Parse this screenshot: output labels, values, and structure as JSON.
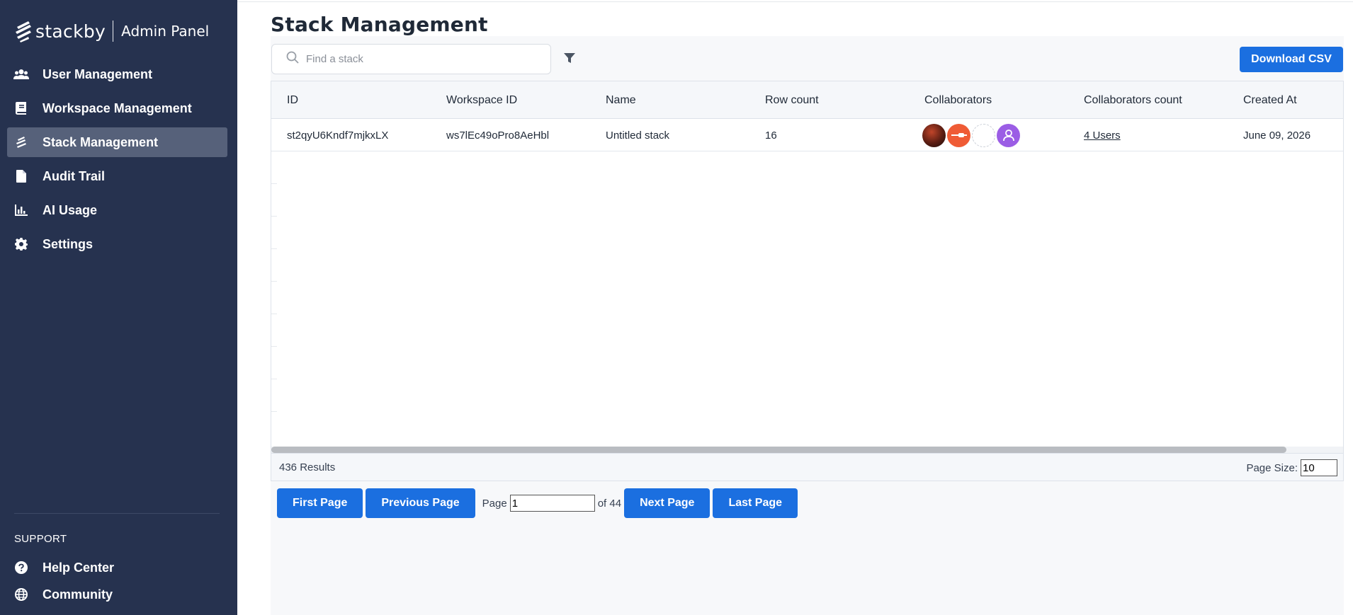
{
  "brand": {
    "name": "stackby",
    "panel": "Admin Panel"
  },
  "sidebar": {
    "items": [
      {
        "label": "User Management",
        "icon": "users-icon",
        "active": false
      },
      {
        "label": "Workspace Management",
        "icon": "book-icon",
        "active": false
      },
      {
        "label": "Stack Management",
        "icon": "stack-icon",
        "active": true
      },
      {
        "label": "Audit Trail",
        "icon": "file-icon",
        "active": false
      },
      {
        "label": "AI Usage",
        "icon": "bar-chart-icon",
        "active": false
      },
      {
        "label": "Settings",
        "icon": "gear-icon",
        "active": false
      }
    ],
    "support_title": "SUPPORT",
    "support_items": [
      {
        "label": "Help Center",
        "icon": "question-icon"
      },
      {
        "label": "Community",
        "icon": "globe-icon"
      }
    ]
  },
  "page": {
    "title": "Stack Management"
  },
  "search": {
    "placeholder": "Find a stack",
    "value": ""
  },
  "toolbar": {
    "download_csv": "Download CSV"
  },
  "table": {
    "columns": [
      "ID",
      "Workspace ID",
      "Name",
      "Row count",
      "Collaborators",
      "Collaborators count",
      "Created At"
    ],
    "rows": [
      {
        "id": "st2qyU6Kndf7mjkxLX",
        "workspace_id": "ws7lEc49oPro8AeHbl",
        "name": "Untitled stack",
        "row_count": "16",
        "collaborators_count": "4 Users",
        "created_at": "June 09, 2026"
      }
    ]
  },
  "footer": {
    "results": "436 Results",
    "page_size_label": "Page Size:",
    "page_size": "10"
  },
  "pagination": {
    "first": "First Page",
    "previous": "Previous Page",
    "page_label": "Page",
    "page_value": "1",
    "of_label": "of 44",
    "next": "Next Page",
    "last": "Last Page"
  },
  "colors": {
    "sidebar": "#26324f",
    "active": "#56617a",
    "primary": "#1b6fe0"
  }
}
